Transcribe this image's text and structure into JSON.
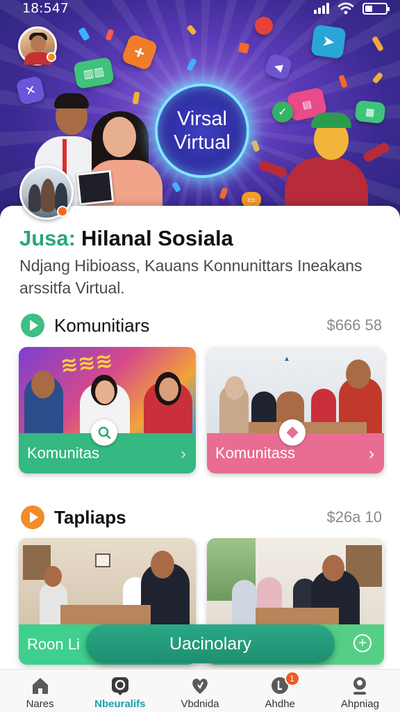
{
  "status_bar": {
    "time": "18:547"
  },
  "hero": {
    "center_line1": "Virsal",
    "center_line2": "Virtual"
  },
  "header": {
    "title_prefix": "Jusa:",
    "title_main": "Hilanal Sosiala",
    "subtitle": "Ndjang Hibioass, Kauans Konnunittars Ineakans arssitfa Virtual."
  },
  "sections": [
    {
      "title": "Komunitiars",
      "count": "$666 58",
      "icon": "play-icon",
      "color": "#3dbf85",
      "cards": [
        {
          "label": "Komunitas",
          "color": "#35b882",
          "badge_icon": "search-icon"
        },
        {
          "label": "Komunitass",
          "color": "#e96d93",
          "badge_icon": "diamond-icon"
        }
      ]
    },
    {
      "title": "Tapliaps",
      "count": "$26a 10",
      "icon": "play-icon",
      "color": "#f28b2a",
      "cards": [
        {
          "label": "Roon Li",
          "color": "#3fcf8e"
        },
        {
          "label": "",
          "color": "#56cf86",
          "badge_icon": "plus-circle-icon"
        }
      ]
    }
  ],
  "fab": {
    "label": "Uacinolary"
  },
  "bottom_nav": [
    {
      "label": "Nares",
      "icon": "home-icon"
    },
    {
      "label": "Nbeuralifs",
      "icon": "chat-icon",
      "active": true
    },
    {
      "label": "Vbdnida",
      "icon": "heart-icon"
    },
    {
      "label": "Ahdhe",
      "icon": "bell-icon",
      "badge": "1"
    },
    {
      "label": "Ahpniag",
      "icon": "profile-icon"
    }
  ]
}
